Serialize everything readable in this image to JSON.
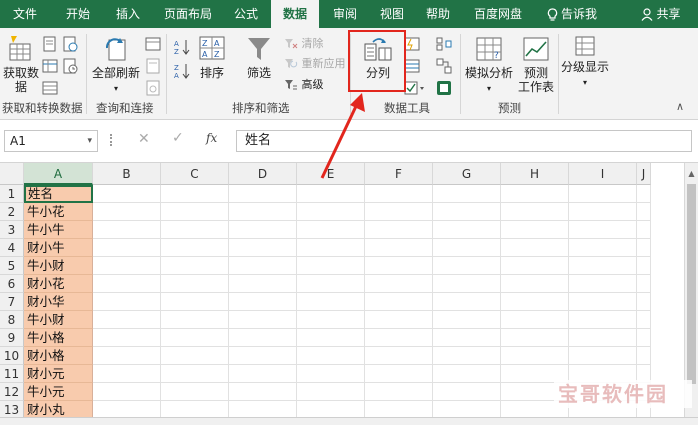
{
  "tabs": [
    "文件",
    "开始",
    "插入",
    "页面布局",
    "公式",
    "数据",
    "审阅",
    "视图",
    "帮助",
    "百度网盘",
    "告诉我",
    "共享"
  ],
  "active_tab": "数据",
  "ribbon": {
    "get_data": {
      "btn": "获取数",
      "btn2": "据",
      "group": "获取和转换数据"
    },
    "queries": {
      "refresh_all": "全部刷新",
      "group": "查询和连接"
    },
    "sort_filter": {
      "sort": "排序",
      "filter": "筛选",
      "clear": "清除",
      "reapply": "重新应用",
      "advanced": "高级",
      "group": "排序和筛选"
    },
    "data_tools": {
      "text_to_columns": "分列",
      "group": "数据工具"
    },
    "forecast": {
      "what_if": "模拟分析",
      "forecast_sheet": "预测",
      "forecast_sheet2": "工作表",
      "group": "预测"
    },
    "outline": {
      "label": "分级显示"
    }
  },
  "formula_bar": {
    "name_box": "A1",
    "fx": "fx",
    "content": "姓名"
  },
  "columns": [
    "A",
    "B",
    "C",
    "D",
    "E",
    "F",
    "G",
    "H",
    "I",
    "J"
  ],
  "rows": [
    {
      "n": "1",
      "a": "姓名"
    },
    {
      "n": "2",
      "a": "牛小花"
    },
    {
      "n": "3",
      "a": "牛小牛"
    },
    {
      "n": "4",
      "a": "财小牛"
    },
    {
      "n": "5",
      "a": "牛小财"
    },
    {
      "n": "6",
      "a": "财小花"
    },
    {
      "n": "7",
      "a": "财小华"
    },
    {
      "n": "8",
      "a": "牛小财"
    },
    {
      "n": "9",
      "a": "牛小格"
    },
    {
      "n": "10",
      "a": "财小格"
    },
    {
      "n": "11",
      "a": "财小元"
    },
    {
      "n": "12",
      "a": "牛小元"
    },
    {
      "n": "13",
      "a": "财小丸"
    }
  ],
  "watermark": "宝哥软件园",
  "colors": {
    "accent": "#217346",
    "highlight": "#e2261d",
    "cell_fill": "#f8cbad"
  }
}
